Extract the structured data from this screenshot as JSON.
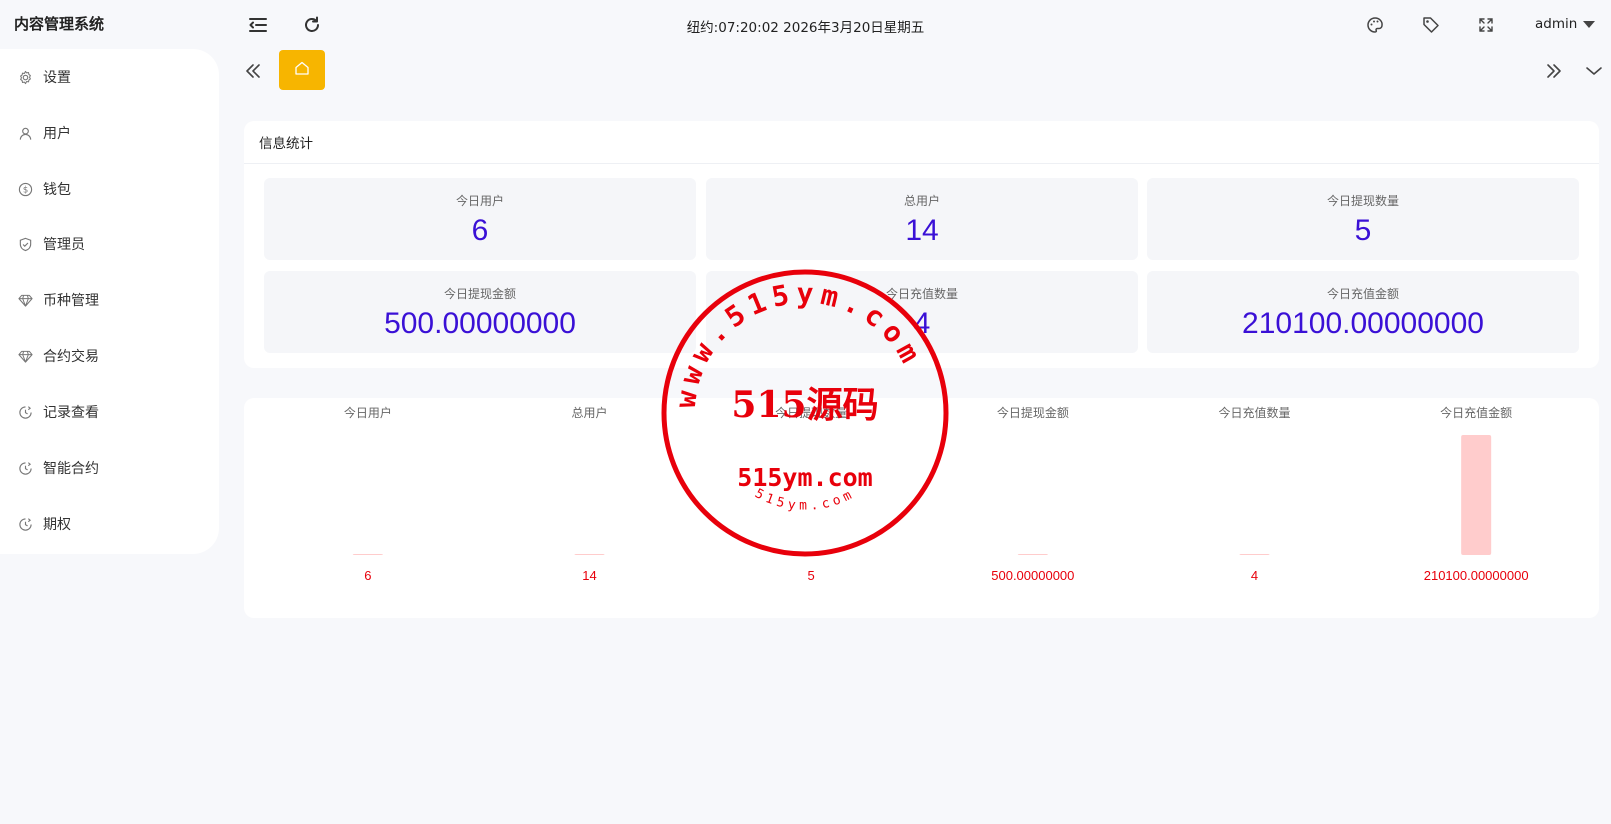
{
  "app": {
    "title": "内容管理系统"
  },
  "header": {
    "datetime": "纽约:07:20:02 2026年3月20日星期五",
    "user": "admin",
    "icons": [
      "menu-fold-icon",
      "refresh-icon",
      "palette-icon",
      "tag-icon",
      "fullscreen-icon"
    ]
  },
  "sidebar": {
    "items": [
      {
        "label": "设置",
        "icon": "gear-icon"
      },
      {
        "label": "用户",
        "icon": "user-icon"
      },
      {
        "label": "钱包",
        "icon": "coin-icon"
      },
      {
        "label": "管理员",
        "icon": "shield-icon"
      },
      {
        "label": "币种管理",
        "icon": "diamond-icon"
      },
      {
        "label": "合约交易",
        "icon": "diamond-icon"
      },
      {
        "label": "记录查看",
        "icon": "clock-icon"
      },
      {
        "label": "智能合约",
        "icon": "clock-icon"
      },
      {
        "label": "期权",
        "icon": "clock-icon"
      }
    ]
  },
  "tabs": {
    "home_icon": "home-icon"
  },
  "stats": {
    "title": "信息统计",
    "items": [
      {
        "label": "今日用户",
        "value": "6"
      },
      {
        "label": "总用户",
        "value": "14"
      },
      {
        "label": "今日提现数量",
        "value": "5"
      },
      {
        "label": "今日提现金额",
        "value": "500.00000000"
      },
      {
        "label": "今日充值数量",
        "value": "4"
      },
      {
        "label": "今日充值金额",
        "value": "210100.00000000"
      }
    ]
  },
  "chart_data": {
    "type": "bar",
    "categories": [
      "今日用户",
      "总用户",
      "今日提现数量",
      "今日提现金额",
      "今日充值数量",
      "今日充值金额"
    ],
    "values": [
      6,
      14,
      5,
      500,
      4,
      210100
    ],
    "value_labels": [
      "6",
      "14",
      "5",
      "500.00000000",
      "4",
      "210100.00000000"
    ],
    "ylim": [
      0,
      210100
    ],
    "bar_color": "#ffcccc",
    "label_color": "#e8000b",
    "grid": false
  },
  "watermark": {
    "center_text": "515源码",
    "domain_text": "515ym.com",
    "ring_text": "www.515ym.com",
    "bottom_text": "515ym.com",
    "color": "#e8000b"
  },
  "colors": {
    "accent": "#f7b500",
    "stat_value": "#3a10d6"
  }
}
